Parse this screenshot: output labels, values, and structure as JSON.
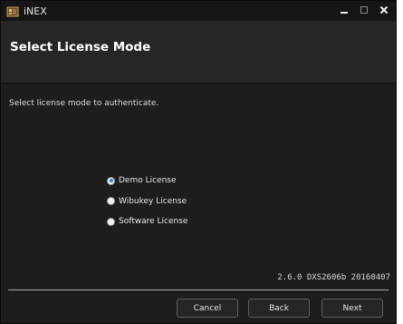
{
  "window": {
    "title": "iNEX",
    "app_icon": "inex-app-icon",
    "controls": [
      "minimize-icon",
      "maximize-icon",
      "close-icon"
    ]
  },
  "header": {
    "title": "Select License Mode"
  },
  "main": {
    "instruction": "Select license mode to authenticate.",
    "license_options": [
      {
        "label": "Demo License",
        "selected": true
      },
      {
        "label": "Wibukey License",
        "selected": false
      },
      {
        "label": "Software License",
        "selected": false
      }
    ],
    "version": "2.6.0 DXS2606b 20160407"
  },
  "footer": {
    "cancel_label": "Cancel",
    "back_label": "Back",
    "next_label": "Next"
  },
  "colors": {
    "window_bg": "#1d1d1d",
    "titlebar_bg": "#151515",
    "header_bg": "#262626",
    "radio_accent": "#2a7fd6",
    "text": "#e6e6e6"
  }
}
